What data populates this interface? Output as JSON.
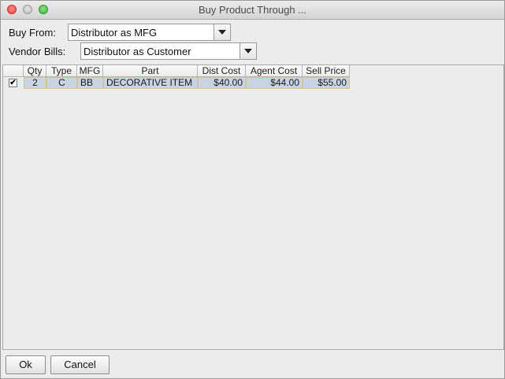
{
  "window": {
    "title": "Buy Product Through ..."
  },
  "form": {
    "buy_from_label": "Buy From:",
    "buy_from_value": "Distributor as MFG",
    "vendor_bills_label": "Vendor Bills:",
    "vendor_bills_value": "Distributor as Customer"
  },
  "table": {
    "columns": [
      "",
      "Qty",
      "Type",
      "MFG",
      "Part",
      "Dist Cost",
      "Agent Cost",
      "Sell Price"
    ],
    "rows": [
      {
        "checked": "✔",
        "qty": "2",
        "type": "C",
        "mfg": "BB",
        "part": "DECORATIVE ITEM",
        "dist_cost": "$40.00",
        "agent_cost": "$44.00",
        "sell_price": "$55.00"
      }
    ]
  },
  "buttons": {
    "ok_label": "Ok",
    "cancel_label": "Cancel"
  },
  "icons": {
    "close": "close-icon",
    "minimize": "minimize-icon",
    "maximize": "maximize-icon",
    "dropdown": "chevron-down-icon"
  }
}
